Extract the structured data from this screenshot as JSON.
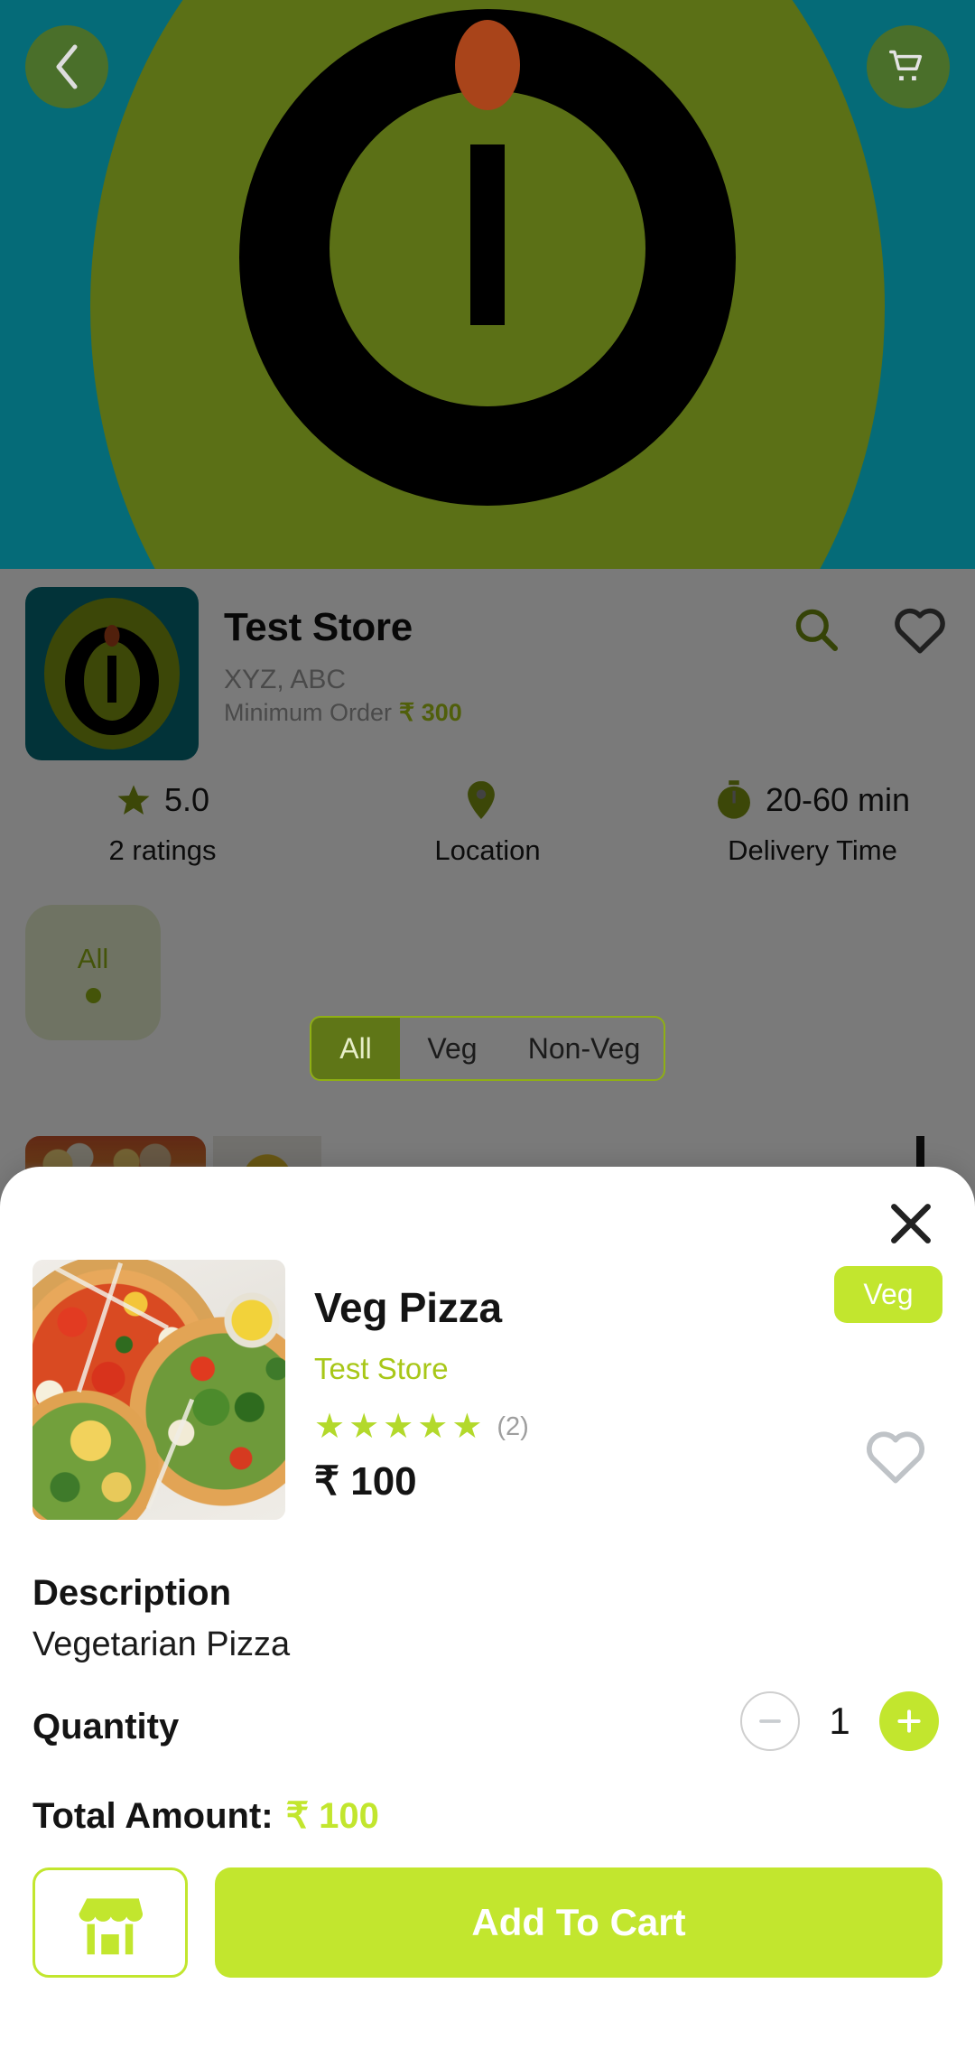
{
  "hero": {
    "back_icon": "chevron-left-icon",
    "cart_icon": "shopping-cart-icon"
  },
  "store": {
    "name": "Test Store",
    "address": "XYZ, ABC",
    "minimum_order_label": "Minimum Order",
    "minimum_order_amount": "₹ 300",
    "search_icon": "search-icon",
    "favorite_icon": "heart-outline-icon",
    "logo_icon": "store-logo-icon"
  },
  "stats": [
    {
      "icon": "star-icon",
      "value": "5.0",
      "label": "2 ratings"
    },
    {
      "icon": "map-pin-icon",
      "value": "",
      "label": "Location"
    },
    {
      "icon": "stopwatch-icon",
      "value": "20-60 min",
      "label": "Delivery Time"
    }
  ],
  "category_chip": {
    "label": "All"
  },
  "veg_filter": {
    "options": [
      "All",
      "Veg",
      "Non-Veg"
    ],
    "selected": "All"
  },
  "sheet": {
    "close_icon": "close-icon",
    "product": {
      "image_alt": "veg-pizza-photo",
      "name": "Veg Pizza",
      "store": "Test Store",
      "stars": 5,
      "rating_count": "(2)",
      "price": "₹ 100",
      "badge": "Veg",
      "favorite_icon": "heart-outline-icon"
    },
    "description": {
      "title": "Description",
      "text": "Vegetarian Pizza"
    },
    "quantity": {
      "label": "Quantity",
      "value": "1",
      "decrement_icon": "minus-icon",
      "increment_icon": "plus-icon"
    },
    "total": {
      "label": "Total Amount:",
      "amount": "₹ 100"
    },
    "actions": {
      "store_icon": "storefront-icon",
      "add_to_cart_label": "Add To Cart"
    }
  },
  "colors": {
    "accent_green": "#C2E62E",
    "olive": "#5B7016",
    "teal": "#056B78",
    "lime_text": "#A8C718"
  }
}
